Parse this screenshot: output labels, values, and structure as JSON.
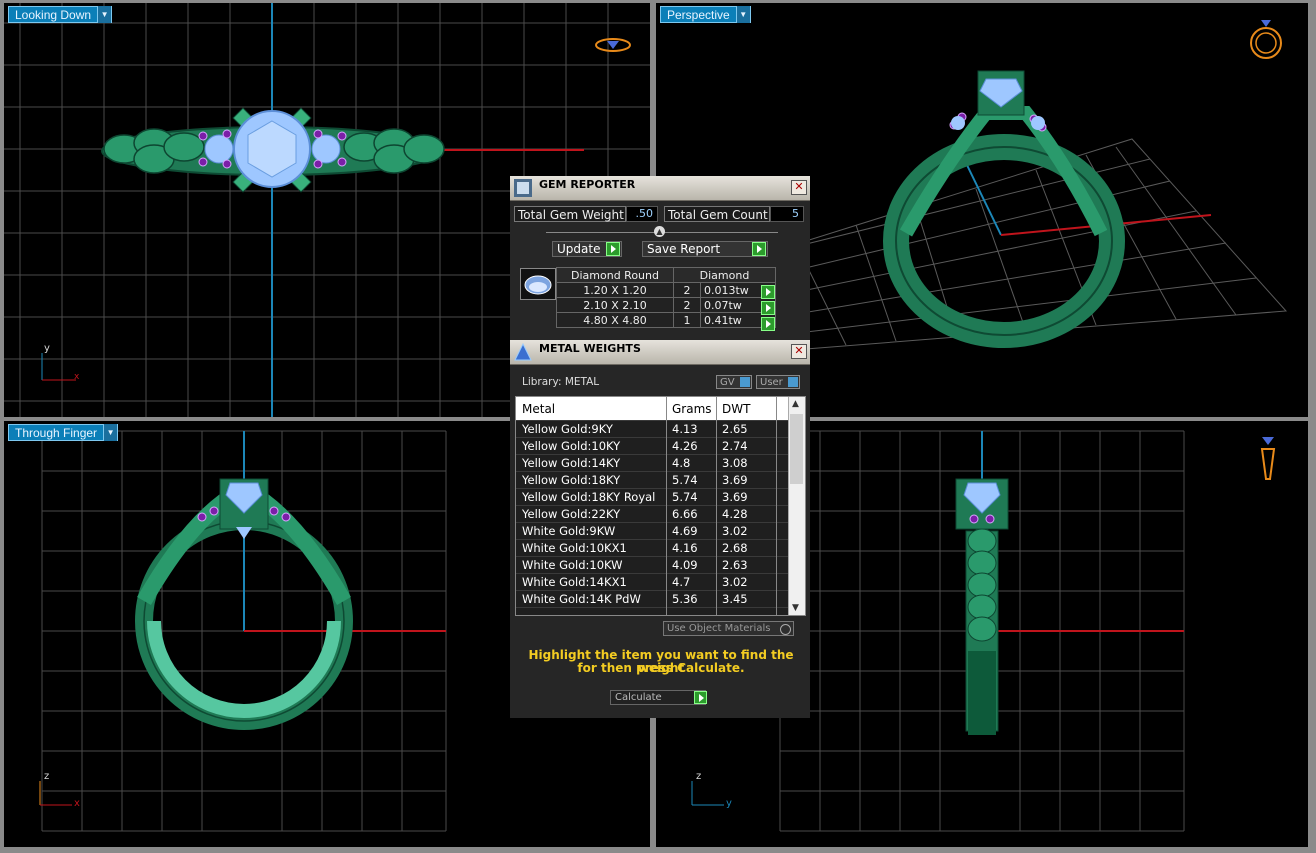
{
  "viewports": {
    "top_left": {
      "label": "Looking Down",
      "axis1": "y",
      "axis2": "x"
    },
    "top_right": {
      "label": "Perspective"
    },
    "bottom_left": {
      "label": "Through Finger",
      "axis1": "z",
      "axis2": "x"
    },
    "bottom_right": {
      "axis1": "z",
      "axis2": "y"
    }
  },
  "gem_reporter": {
    "title": "GEM REPORTER",
    "total_weight_label": "Total Gem Weight",
    "total_weight_value": ".50",
    "total_count_label": "Total Gem Count",
    "total_count_value": "5",
    "update_label": "Update",
    "save_label": "Save Report",
    "table": {
      "header1": "Diamond Round",
      "header2": "Diamond",
      "rows": [
        {
          "size": "1.20 X 1.20",
          "count": "2",
          "weight": "0.013tw"
        },
        {
          "size": "2.10 X 2.10",
          "count": "2",
          "weight": "0.07tw"
        },
        {
          "size": "4.80 X 4.80",
          "count": "1",
          "weight": "0.41tw"
        }
      ]
    }
  },
  "metal_weights": {
    "title": "METAL WEIGHTS",
    "library_label": "Library:  METAL",
    "gv_label": "GV",
    "user_label": "User",
    "columns": {
      "metal": "Metal",
      "grams": "Grams",
      "dwt": "DWT"
    },
    "rows": [
      {
        "metal": "Yellow Gold:9KY",
        "grams": "4.13",
        "dwt": "2.65"
      },
      {
        "metal": "Yellow Gold:10KY",
        "grams": "4.26",
        "dwt": "2.74"
      },
      {
        "metal": "Yellow Gold:14KY",
        "grams": "4.8",
        "dwt": "3.08"
      },
      {
        "metal": "Yellow Gold:18KY",
        "grams": "5.74",
        "dwt": "3.69"
      },
      {
        "metal": "Yellow Gold:18KY Royal",
        "grams": "5.74",
        "dwt": "3.69"
      },
      {
        "metal": "Yellow Gold:22KY",
        "grams": "6.66",
        "dwt": "4.28"
      },
      {
        "metal": "White Gold:9KW",
        "grams": "4.69",
        "dwt": "3.02"
      },
      {
        "metal": "White Gold:10KX1",
        "grams": "4.16",
        "dwt": "2.68"
      },
      {
        "metal": "White Gold:10KW",
        "grams": "4.09",
        "dwt": "2.63"
      },
      {
        "metal": "White Gold:14KX1",
        "grams": "4.7",
        "dwt": "3.02"
      },
      {
        "metal": "White Gold:14K PdW",
        "grams": "5.36",
        "dwt": "3.45"
      }
    ],
    "use_object_materials": "Use Object Materials",
    "hint_line1": "Highlight the item you want to find the weight",
    "hint_line2": "for then press Calculate.",
    "calculate_label": "Calculate"
  },
  "colors": {
    "ring": "#1f7a55",
    "gem": "#9ec7ff",
    "accent_gem": "#7b1fa8",
    "red_axis": "#c0141c",
    "blue_axis": "#1c87b8"
  }
}
